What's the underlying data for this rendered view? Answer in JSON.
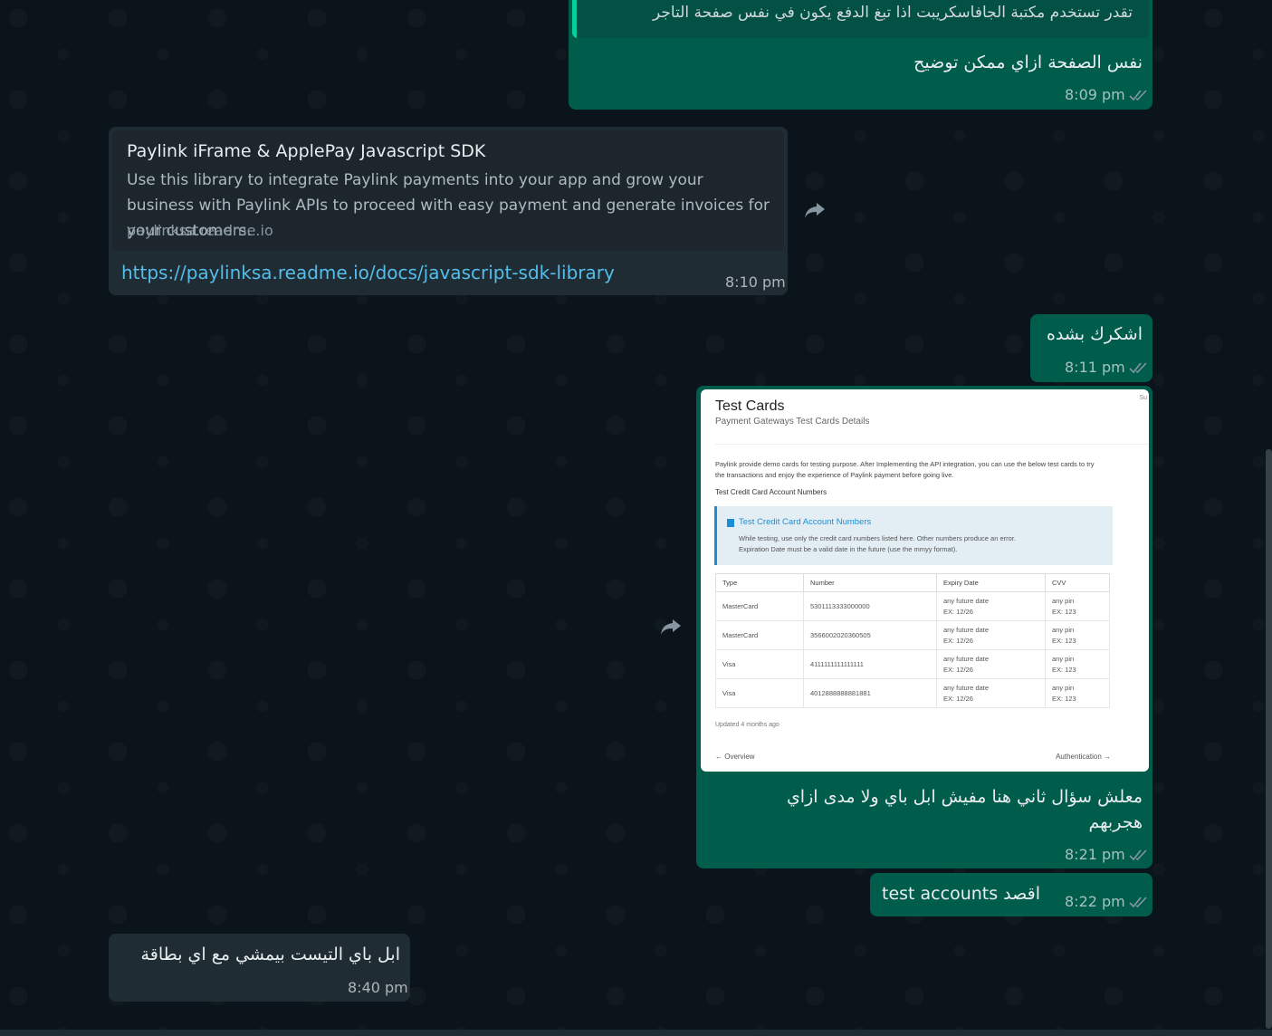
{
  "colors": {
    "outgoing": "#005c4b",
    "incoming": "#202c33",
    "link": "#53bdeb",
    "background": "#0b141a"
  },
  "messages": {
    "m1": {
      "quote": "تقدر تستخدم مكتبة الجافاسكريبت اذا تبغ الدفع يكون في نفس صفحة التاجر",
      "text": "نفس الصفحة ازاي ممكن توضيح",
      "time": "8:09 pm"
    },
    "m2": {
      "preview_title": "Paylink iFrame & ApplePay Javascript SDK",
      "preview_desc": "Use this library to integrate Paylink payments into your app and grow your business with Paylink APIs to proceed with easy payment and generate invoices for your customers.",
      "preview_domain": "paylinksa.readme.io",
      "link": "https://paylinksa.readme.io/docs/javascript-sdk-library",
      "time": "8:10 pm"
    },
    "m3": {
      "text": "اشكرك بشده",
      "time": "8:11 pm"
    },
    "m4": {
      "image": {
        "title": "Test Cards",
        "subtitle": "Payment Gateways Test Cards Details",
        "paragraph": "Paylink provide demo cards for testing purpose. After Implementing the API integration, you can use the below test cards to try the transactions and enjoy the experience of Paylink payment before going live.",
        "section": "Test Credit Card Account Numbers",
        "callout_title": "Test Credit Card Account Numbers",
        "callout_line1": "While testing, use only the credit card numbers listed here. Other numbers produce an error.",
        "callout_line2": "Expiration Date must be a valid date in the future (use the mmyy format).",
        "headers": [
          "Type",
          "Number",
          "Expiry Date",
          "CVV"
        ],
        "rows": [
          {
            "type": "MasterCard",
            "number": "5301113333000000",
            "expiry1": "any future date",
            "expiry2": "EX: 12/26",
            "cvv1": "any pin",
            "cvv2": "EX: 123"
          },
          {
            "type": "MasterCard",
            "number": "3566002020360505",
            "expiry1": "any future date",
            "expiry2": "EX: 12/26",
            "cvv1": "any pin",
            "cvv2": "EX: 123"
          },
          {
            "type": "Visa",
            "number": "4111111111111111",
            "expiry1": "any future date",
            "expiry2": "EX: 12/26",
            "cvv1": "any pin",
            "cvv2": "EX: 123"
          },
          {
            "type": "Visa",
            "number": "4012888888881881",
            "expiry1": "any future date",
            "expiry2": "EX: 12/26",
            "cvv1": "any pin",
            "cvv2": "EX: 123"
          }
        ],
        "updated": "Updated 4 months ago",
        "nav_prev": "← Overview",
        "nav_next": "Authentication →",
        "corner": "Su"
      },
      "text_line1": "معلش سؤال ثاني هنا مفيش ابل باي ولا مدى ازاي",
      "text_line2": "هجربهم",
      "time": "8:21 pm"
    },
    "m5": {
      "text": "test accounts اقصد",
      "time": "8:22 pm"
    },
    "m6": {
      "text": "ابل باي التيست بيمشي مع اي بطاقة",
      "time": "8:40 pm"
    }
  },
  "icons": {
    "ticks": "double-check-icon",
    "forward": "forward-icon"
  }
}
